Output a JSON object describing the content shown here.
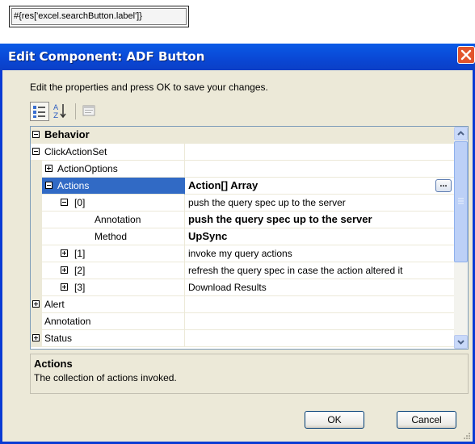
{
  "chip": {
    "text": "#{res['excel.searchButton.label']}"
  },
  "dialog": {
    "title": "Edit Component: ADF Button",
    "instructions": "Edit the properties and press OK to save your changes.",
    "toolbar": {
      "categorized_icon": "categorized-icon",
      "alphabetical_icon": "sort-az-icon",
      "pages_icon": "property-pages-icon"
    },
    "rows": [
      {
        "name": "Behavior",
        "value": ""
      },
      {
        "name": "ClickActionSet",
        "value": ""
      },
      {
        "name": "ActionOptions",
        "value": ""
      },
      {
        "name": "Actions",
        "value": "Action[] Array",
        "button": "..."
      },
      {
        "name": "[0]",
        "value": "push the query spec up to the server"
      },
      {
        "name": "Annotation",
        "value": "push the query spec up to the server"
      },
      {
        "name": "Method",
        "value": "UpSync"
      },
      {
        "name": "[1]",
        "value": "invoke my query actions"
      },
      {
        "name": "[2]",
        "value": "refresh the query spec in case the action altered it"
      },
      {
        "name": "[3]",
        "value": "Download Results"
      },
      {
        "name": "Alert",
        "value": ""
      },
      {
        "name": "Annotation",
        "value": ""
      },
      {
        "name": "Status",
        "value": ""
      }
    ],
    "description": {
      "title": "Actions",
      "text": "The collection of actions invoked."
    },
    "buttons": {
      "ok": "OK",
      "cancel": "Cancel"
    },
    "colors": {
      "title_bar": "#0a48d6",
      "selection": "#316ac5",
      "dialog_bg": "#ece9d8"
    }
  }
}
